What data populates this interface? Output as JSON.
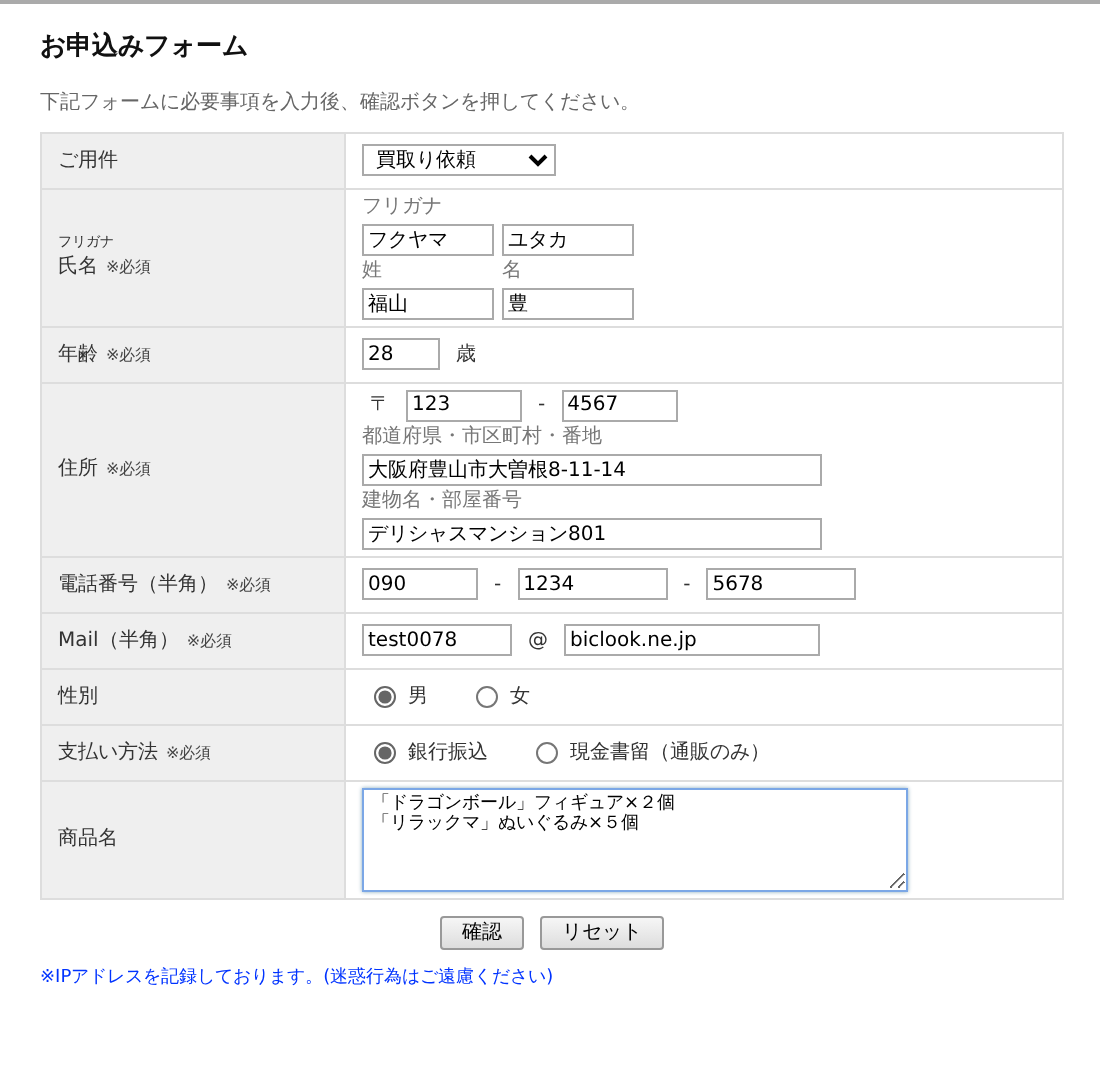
{
  "title": "お申込みフォーム",
  "intro": "下記フォームに必要事項を入力後、確認ボタンを押してください。",
  "rows": [
    {
      "label": "ご用件",
      "items": [
        {
          "kind": "select",
          "value": "買取り依頼"
        }
      ]
    },
    {
      "note": "フリガナ",
      "label": "氏名",
      "required": "※必須",
      "items": [
        {
          "kind": "caption",
          "text": "フリガナ"
        },
        {
          "kind": "break"
        },
        {
          "kind": "medium-input",
          "value": "フクヤマ"
        },
        {
          "kind": "medium-input",
          "value": "ユタカ"
        },
        {
          "kind": "break"
        },
        {
          "kind": "column-caption",
          "text": "姓"
        },
        {
          "kind": "column-caption",
          "text": "名"
        },
        {
          "kind": "break"
        },
        {
          "kind": "medium-input",
          "value": "福山"
        },
        {
          "kind": "medium-input",
          "value": "豊"
        }
      ]
    },
    {
      "label": "年齢",
      "required": "※必須",
      "items": [
        {
          "kind": "tiny-input",
          "value": "28"
        },
        {
          "kind": "text",
          "text": "歳"
        }
      ]
    },
    {
      "label": "住所",
      "required": "※必須",
      "items": [
        {
          "kind": "text",
          "text": "〒"
        },
        {
          "kind": "short-input",
          "value": "123"
        },
        {
          "kind": "text",
          "text": "-"
        },
        {
          "kind": "short-input",
          "value": "4567"
        },
        {
          "kind": "break"
        },
        {
          "kind": "caption",
          "text": "都道府県・市区町村・番地"
        },
        {
          "kind": "break"
        },
        {
          "kind": "full-input",
          "value": "大阪府豊山市大曽根8-11-14"
        },
        {
          "kind": "break"
        },
        {
          "kind": "caption",
          "text": "建物名・部屋番号"
        },
        {
          "kind": "break"
        },
        {
          "kind": "full-input",
          "value": "デリシャスマンション801"
        }
      ]
    },
    {
      "label": "電話番号（半角）",
      "required": "※必須",
      "items": [
        {
          "kind": "short-input",
          "value": "090"
        },
        {
          "kind": "text",
          "text": "-"
        },
        {
          "kind": "phone-input",
          "value": "1234"
        },
        {
          "kind": "text",
          "text": "-"
        },
        {
          "kind": "phone-input",
          "value": "5678"
        }
      ]
    },
    {
      "label": "Mail（半角）",
      "required": "※必須",
      "items": [
        {
          "kind": "phone-input",
          "value": "test0078"
        },
        {
          "kind": "text",
          "text": "@"
        },
        {
          "kind": "long-input",
          "value": "biclook.ne.jp"
        }
      ]
    },
    {
      "label": "性別",
      "items": [
        {
          "kind": "radio",
          "text": "男",
          "selected": true
        },
        {
          "kind": "radio",
          "text": "女",
          "selected": false
        }
      ]
    },
    {
      "label": "支払い方法",
      "required": "※必須",
      "items": [
        {
          "kind": "radio",
          "text": "銀行振込",
          "selected": true
        },
        {
          "kind": "radio",
          "text": "現金書留（通販のみ）",
          "selected": false
        }
      ]
    },
    {
      "label": "商品名",
      "items": [
        {
          "kind": "textarea",
          "lines": [
            "「ドラゴンボール」フィギュア×２個",
            "「リラックマ」ぬいぐるみ×５個"
          ]
        }
      ]
    }
  ],
  "buttons": [
    "確認",
    "リセット"
  ],
  "footnote": "※IPアドレスを記録しております。(迷惑行為はご遠慮ください)"
}
